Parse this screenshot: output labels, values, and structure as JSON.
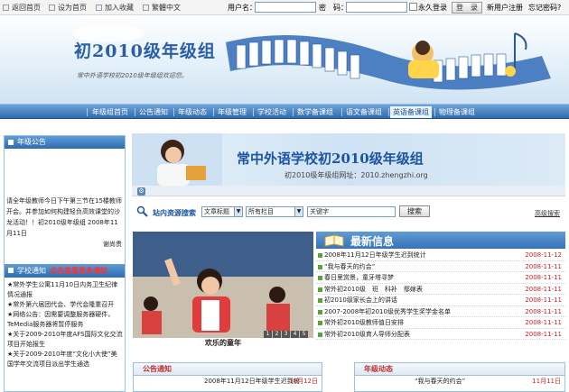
{
  "topbar": {
    "links": [
      {
        "label": "返回首页",
        "icon": "home-icon"
      },
      {
        "label": "设为首页",
        "icon": "homepage-icon"
      },
      {
        "label": "加入收藏",
        "icon": "favorite-icon"
      },
      {
        "label": "繁體中文",
        "icon": "language-icon"
      }
    ],
    "username_label": "用户名：",
    "password_label": "密　码：",
    "remember_label": "永久登录",
    "login_button": "登　录",
    "register_link": "新用户注册",
    "forgot_link": "忘记密码?"
  },
  "banner": {
    "title": "初2010级年级组",
    "subtitle": "常中外语学校初2010级年级组欢迎您。"
  },
  "nav": {
    "items": [
      "年级组首页",
      "公告通知",
      "年级动态",
      "年级管理",
      "学校活动",
      "数学备课组",
      "语文备课组",
      "英语备课组",
      "物理备课组"
    ],
    "active": "英语备课组"
  },
  "sidebar": {
    "notice_title": "年级公告",
    "notice_text": "请全年级教师今日下午第三节在15楼教师开会。并参加如何构建轻负高效课堂的沙龙活动！！初2010级年级组 2008年11月11日",
    "notice_sign": "谢尚贵",
    "school_title": "学校通知",
    "school_highlight": "点击查看更多通知",
    "school_items": [
      "★常外学生公寓11月10日内务卫生纪律情况通报",
      "★常外第六届团代会、学代会隆重召开",
      "★网络公告：因需要调整服务器硬件，TeMedia服务器将暂停服务",
      "★关于2009-2010年度AFS国际文化交流项目开始报生",
      "★关于2009-2010年度“文化小大使”美国学年交流项目派出学生通选"
    ]
  },
  "school_banner": {
    "title": "常中外语学校初2010级年级组",
    "url": "初2010级年级组网址：2010.zhengzhi.org"
  },
  "search": {
    "label": "站内资源搜索",
    "field_select": "文章标题",
    "column_select": "所有栏目",
    "keyword": "关键字",
    "button": "搜索",
    "advanced": "高级搜索"
  },
  "photo": {
    "caption": "欢乐的童年",
    "pages": [
      "1",
      "2",
      "3",
      "4",
      "5"
    ]
  },
  "news": {
    "title": "最新信息",
    "items": [
      {
        "title": "2008年11月12日年级学生迟到统计",
        "date": "2008-11-12"
      },
      {
        "title": "“我与春天的约会”",
        "date": "2008-11-11"
      },
      {
        "title": "春日里赏景，童牙塔寻梦",
        "date": "2008-11-11"
      },
      {
        "title": "常外初2010级　班　科补　鄢嫁表",
        "date": "2008-11-11"
      },
      {
        "title": "初2010级家长会上的讲话",
        "date": "2008-11-11"
      },
      {
        "title": "2007-2008年初2010级优秀学生奖学金名单",
        "date": "2008-11-11"
      },
      {
        "title": "常外初2010级教师值日安排",
        "date": "2008-11-11"
      },
      {
        "title": "常外初2010级育人导师分配表",
        "date": "2008-11-11"
      }
    ]
  },
  "bottom": {
    "announce_title": "公告通知",
    "announce_item": "2008年11月12日年级学生迟到统",
    "announce_date": "11月12日",
    "dynamic_title": "年级动态",
    "dynamic_item": "“我与春天的约会”",
    "dynamic_date": "11月11日"
  },
  "colors": {
    "accent": "#2f6cb0",
    "date_red": "#d02020",
    "title_blue": "#1d54a2"
  }
}
